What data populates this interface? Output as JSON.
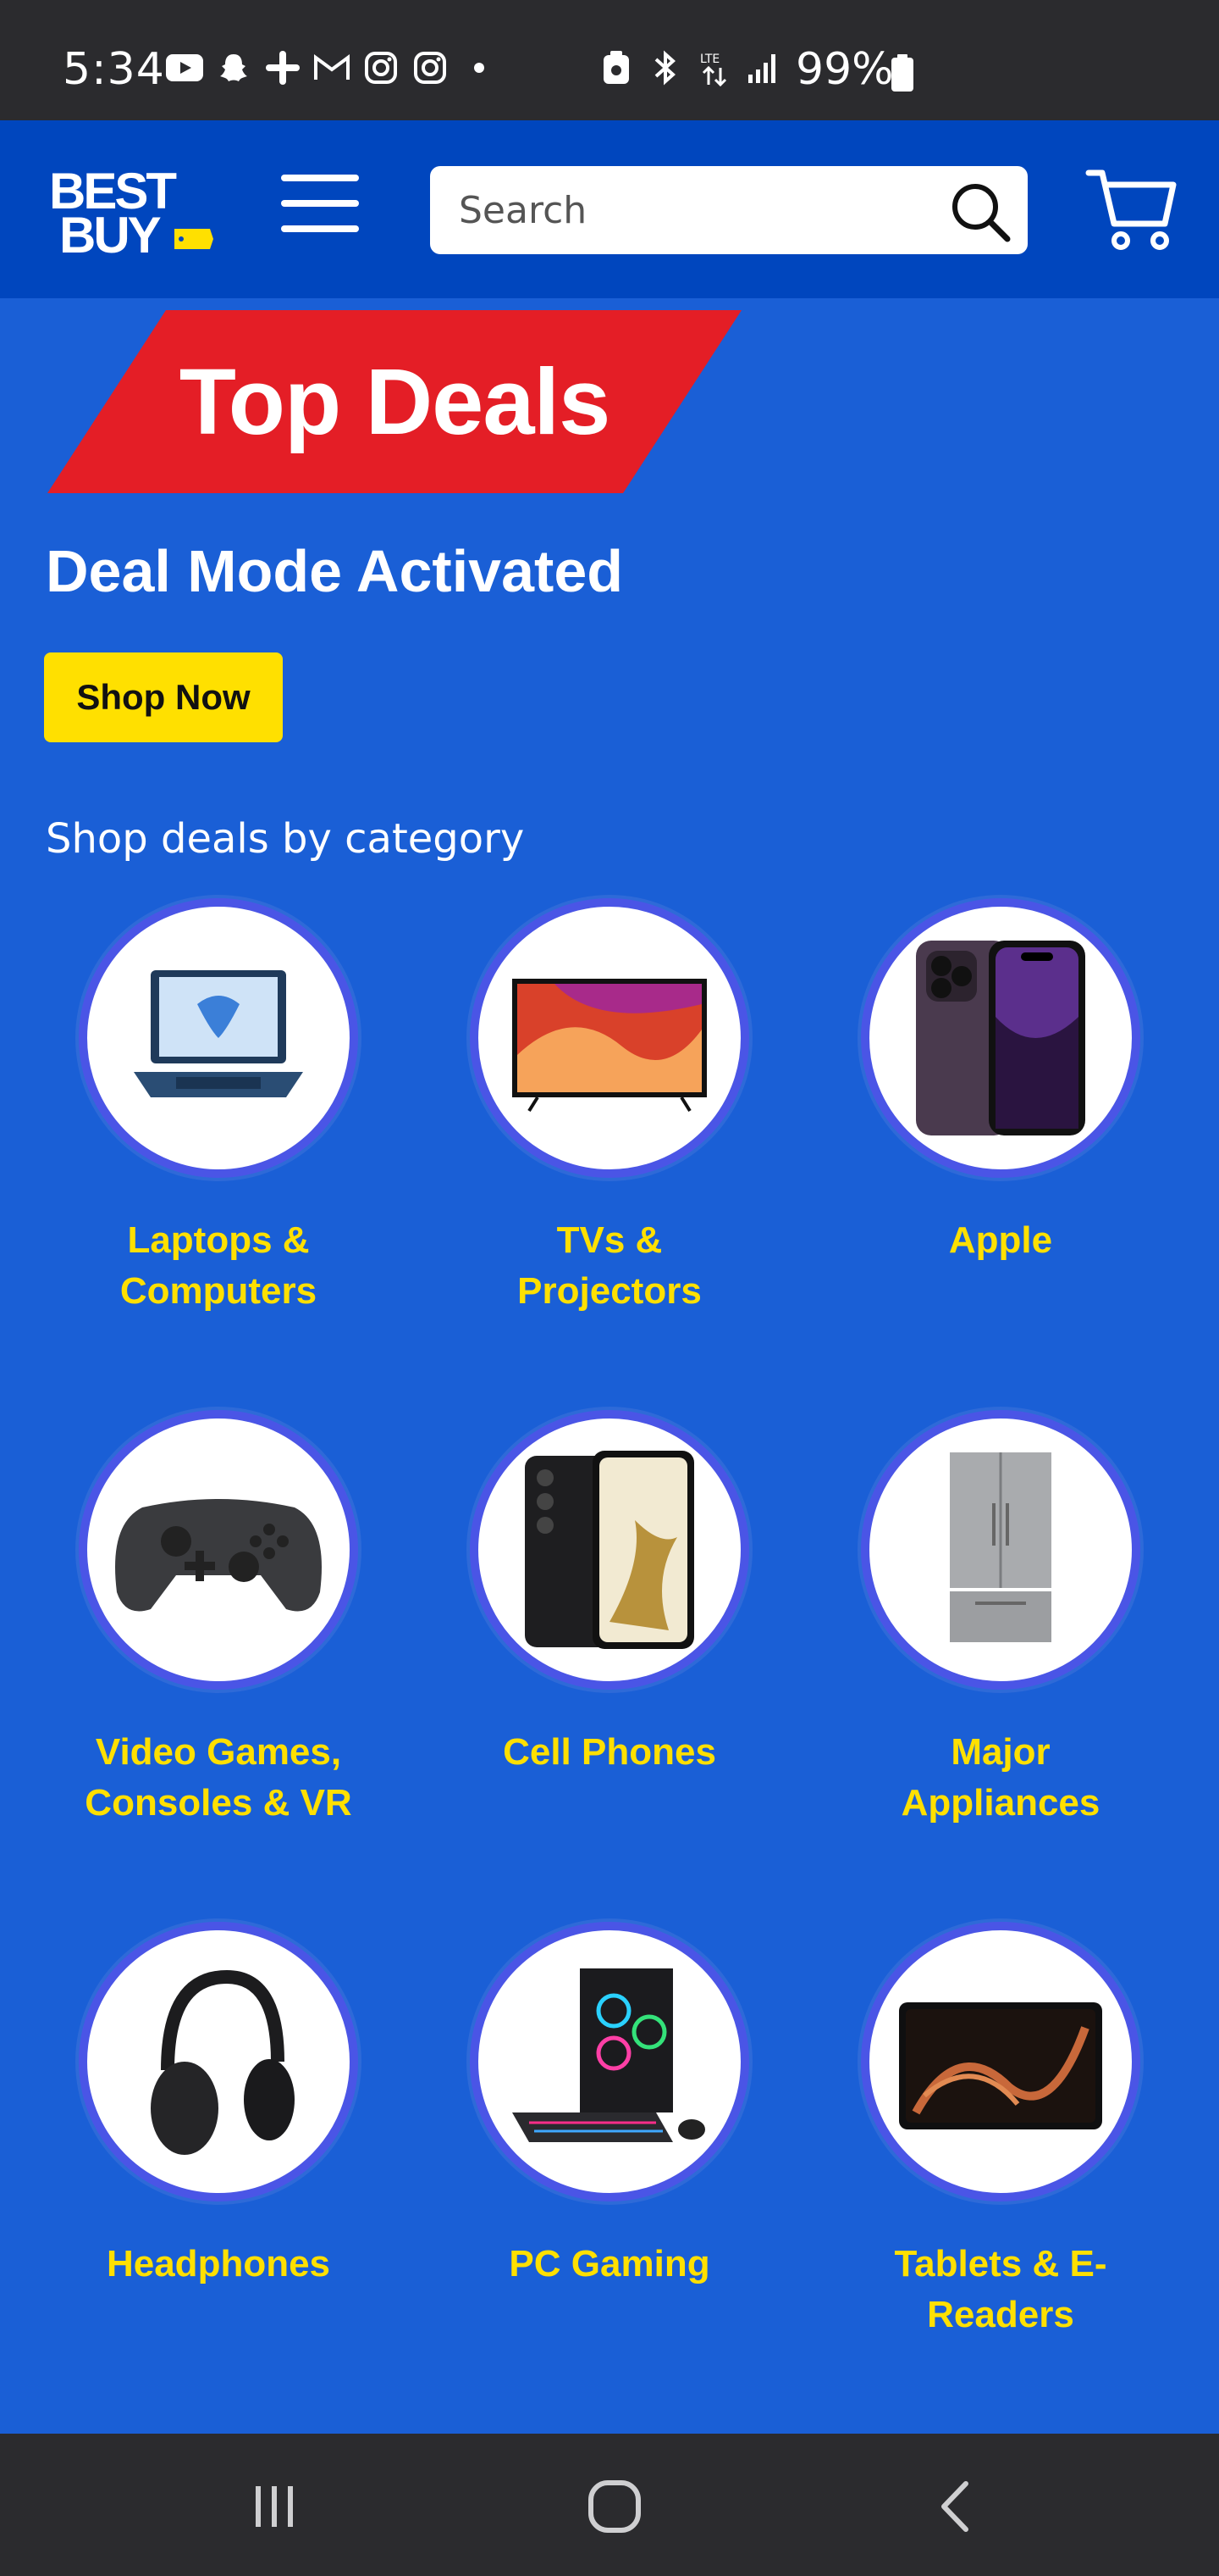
{
  "status_bar": {
    "time": "5:34",
    "battery": "99%",
    "icons_left": [
      "youtube-icon",
      "snapchat-icon",
      "slack-icon",
      "gmail-icon",
      "instagram-icon",
      "instagram-icon",
      "dot-icon"
    ],
    "icons_right": [
      "nfc-icon",
      "bluetooth-icon",
      "data-icon",
      "signal-icon"
    ]
  },
  "header": {
    "logo": {
      "line1": "BEST",
      "line2": "BUY"
    },
    "search": {
      "placeholder": "Search"
    },
    "colors": {
      "brand_blue": "#0046be",
      "brand_yellow": "#ffe000"
    }
  },
  "hero": {
    "title": "Top Deals",
    "subtitle": "Deal Mode Activated",
    "cta": "Shop Now",
    "colors": {
      "banner_red": "#e41e26"
    }
  },
  "categories": {
    "heading": "Shop deals by category",
    "items": [
      {
        "label_line1": "Laptops &",
        "label_line2": "Computers",
        "icon": "laptop-icon"
      },
      {
        "label_line1": "TVs &",
        "label_line2": "Projectors",
        "icon": "tv-icon"
      },
      {
        "label_line1": "Apple",
        "label_line2": "",
        "icon": "iphone-icon"
      },
      {
        "label_line1": "Video Games,",
        "label_line2": "Consoles & VR",
        "icon": "game-controller-icon"
      },
      {
        "label_line1": "Cell Phones",
        "label_line2": "",
        "icon": "cell-phone-icon"
      },
      {
        "label_line1": "Major",
        "label_line2": "Appliances",
        "icon": "refrigerator-icon"
      },
      {
        "label_line1": "Headphones",
        "label_line2": "",
        "icon": "headphones-icon"
      },
      {
        "label_line1": "PC Gaming",
        "label_line2": "",
        "icon": "gaming-pc-icon"
      },
      {
        "label_line1": "Tablets & E-",
        "label_line2": "Readers",
        "icon": "tablet-icon"
      }
    ]
  },
  "nav_bar": {
    "buttons": [
      "recent-apps-icon",
      "home-icon",
      "back-icon"
    ]
  }
}
